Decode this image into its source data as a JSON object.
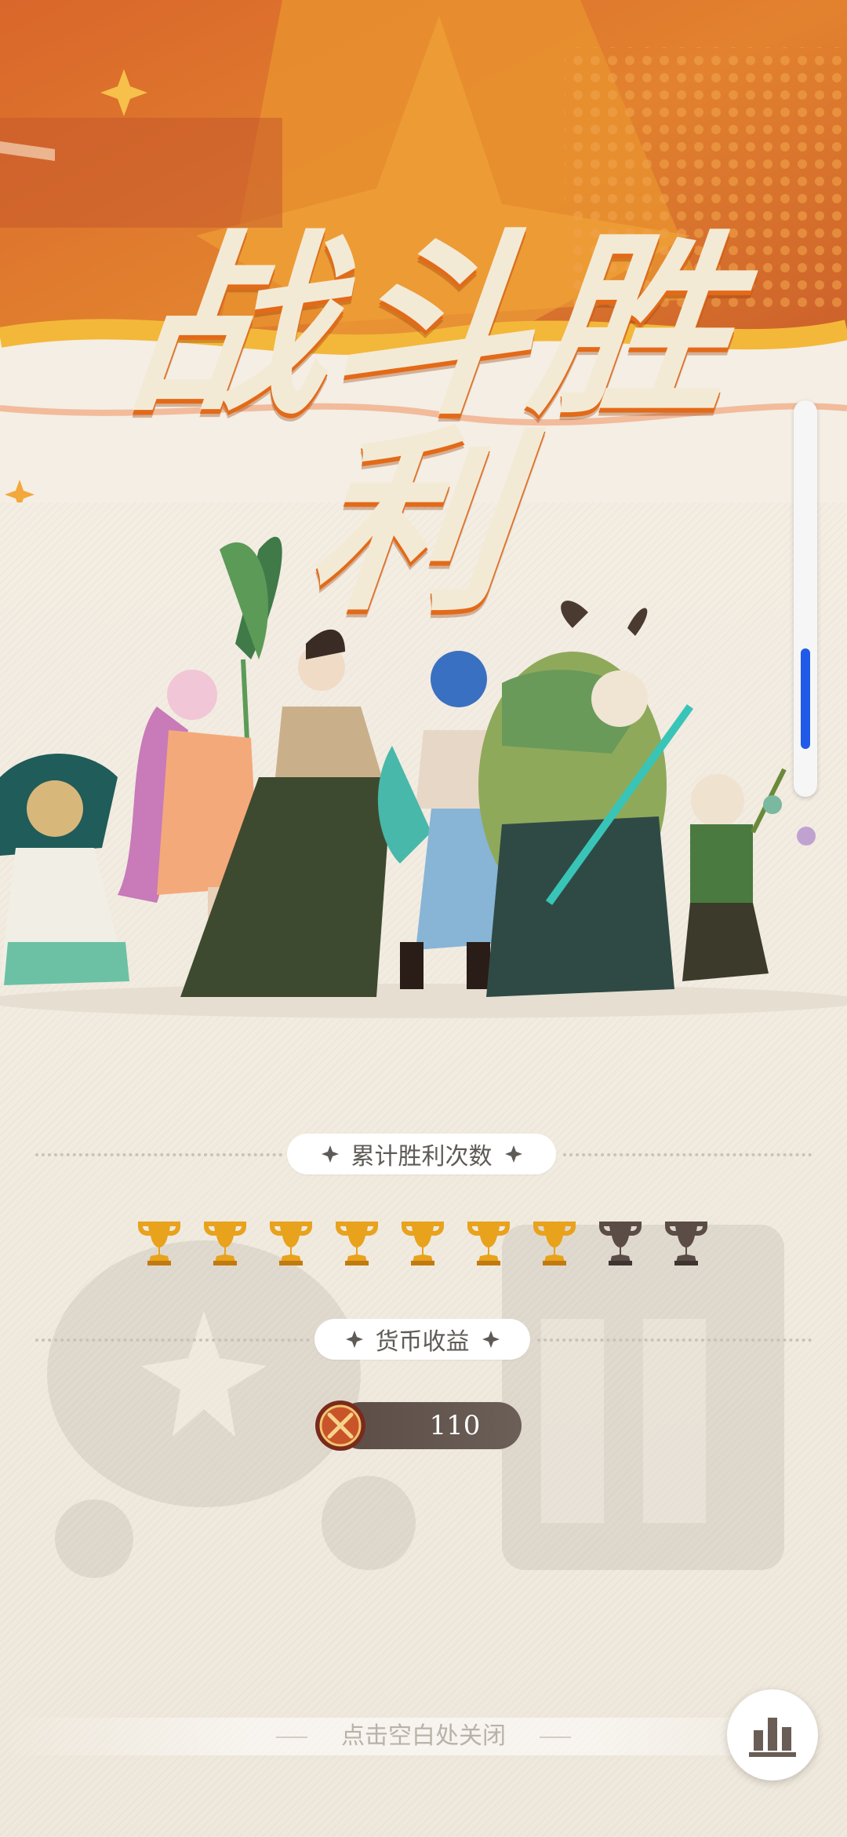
{
  "title": "战斗胜利",
  "victories": {
    "label": "累计胜利次数",
    "earned": 7,
    "total": 9,
    "trophies": [
      {
        "state": "earned"
      },
      {
        "state": "earned"
      },
      {
        "state": "earned"
      },
      {
        "state": "earned"
      },
      {
        "state": "earned"
      },
      {
        "state": "earned"
      },
      {
        "state": "earned"
      },
      {
        "state": "locked"
      },
      {
        "state": "locked"
      }
    ]
  },
  "currency": {
    "label": "货币收益",
    "icon": "crossed-swords-coin-icon",
    "value": "110"
  },
  "close_hint": "点击空白处关闭",
  "stats_button": {
    "icon": "bar-chart-icon"
  },
  "scroll": {
    "position_fraction": 0.85
  },
  "colors": {
    "banner_orange": "#e07a2a",
    "title_cream": "#f3ead6",
    "trophy_gold": "#e8a21c",
    "trophy_locked": "#5b4d46",
    "scroll_thumb": "#1f5ae8"
  }
}
